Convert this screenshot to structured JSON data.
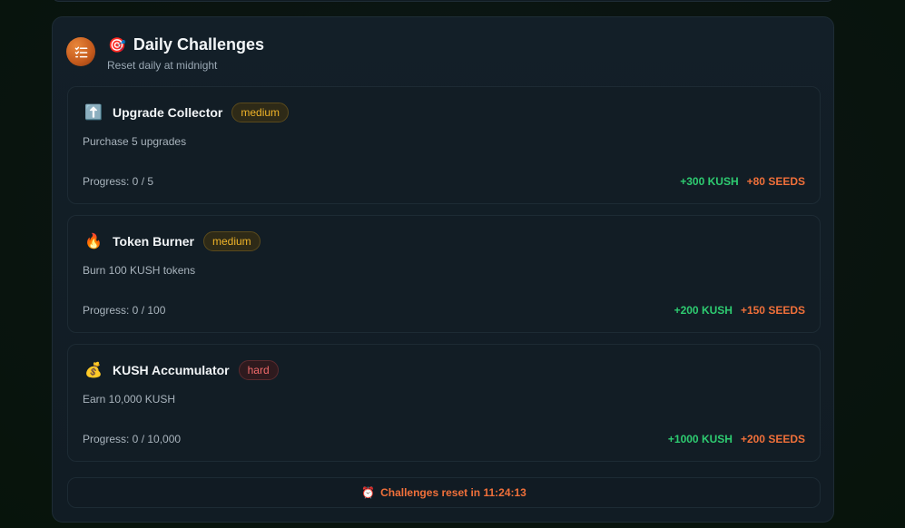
{
  "header": {
    "title_emoji": "🎯",
    "title": "Daily Challenges",
    "subtitle": "Reset daily at midnight",
    "icon": "checklist-icon"
  },
  "challenges": [
    {
      "icon": "⬆️",
      "name": "Upgrade Collector",
      "difficulty": "medium",
      "description": "Purchase 5 upgrades",
      "progress": "Progress: 0 / 5",
      "reward_kush": "+300 KUSH",
      "reward_seeds": "+80 SEEDS"
    },
    {
      "icon": "🔥",
      "name": "Token Burner",
      "difficulty": "medium",
      "description": "Burn 100 KUSH tokens",
      "progress": "Progress: 0 / 100",
      "reward_kush": "+200 KUSH",
      "reward_seeds": "+150 SEEDS"
    },
    {
      "icon": "💰",
      "name": "KUSH Accumulator",
      "difficulty": "hard",
      "description": "Earn 10,000 KUSH",
      "progress": "Progress: 0 / 10,000",
      "reward_kush": "+1000 KUSH",
      "reward_seeds": "+200 SEEDS"
    }
  ],
  "footer": {
    "icon": "⏰",
    "reset_text": "Challenges reset in 11:24:13"
  },
  "colors": {
    "kush": "#2ecc71",
    "seeds": "#f0703a",
    "medium": "#f0b429",
    "hard": "#f06a6a"
  }
}
